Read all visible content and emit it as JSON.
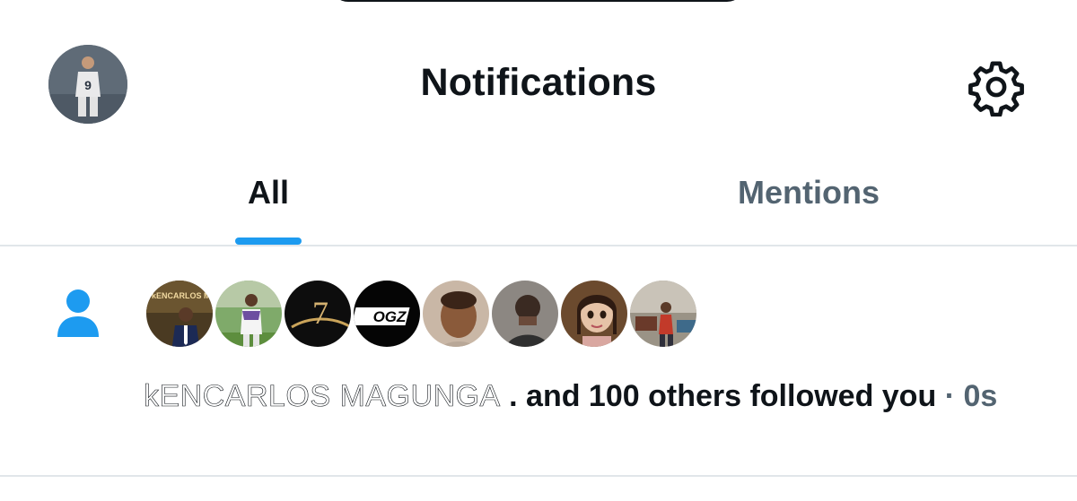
{
  "header": {
    "title": "Notifications",
    "avatar_icon": "profile-avatar",
    "settings_icon": "gear-icon"
  },
  "tabs": [
    {
      "label": "All",
      "active": true
    },
    {
      "label": "Mentions",
      "active": false
    }
  ],
  "notification": {
    "type_icon": "person-icon",
    "name": "kENCARLOS MAGUNGA",
    "action_text": ". and 100 others followed you",
    "separator": "·",
    "time": "0s",
    "followers": [
      {
        "label": "kENCARLOS MAGUNGA"
      },
      {
        "label": ""
      },
      {
        "label": "7"
      },
      {
        "label": "OGZ"
      },
      {
        "label": ""
      },
      {
        "label": ""
      },
      {
        "label": ""
      },
      {
        "label": ""
      }
    ]
  },
  "colors": {
    "accent": "#1d9bf0",
    "text": "#0f1419",
    "muted": "#536471",
    "divider": "#e1e6ea"
  }
}
